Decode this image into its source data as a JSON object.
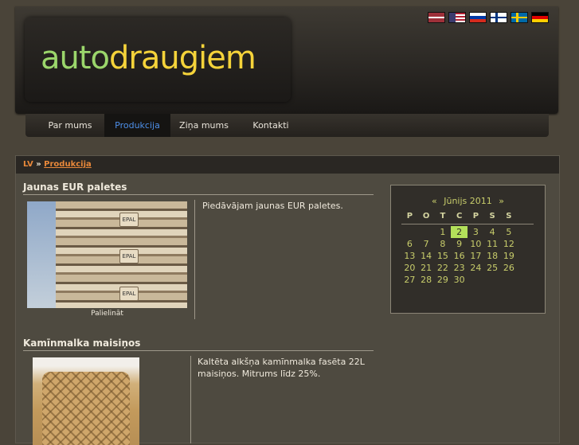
{
  "logo": {
    "part1": "auto",
    "part2": "draugiem"
  },
  "flags": [
    {
      "name": "lv-flag",
      "colors": [
        "#9e3039",
        "#ffffff",
        "#9e3039"
      ]
    },
    {
      "name": "us-flag",
      "colors": [
        "#b22234",
        "#ffffff",
        "#3c3b6e"
      ]
    },
    {
      "name": "ru-flag",
      "colors": [
        "#ffffff",
        "#0039a6",
        "#d52b1e"
      ]
    },
    {
      "name": "fi-flag",
      "colors": [
        "#ffffff",
        "#003580"
      ]
    },
    {
      "name": "se-flag",
      "colors": [
        "#006aa7",
        "#fecc00"
      ]
    },
    {
      "name": "de-flag",
      "colors": [
        "#000000",
        "#dd0000",
        "#ffce00"
      ]
    }
  ],
  "nav": [
    {
      "label": "Par mums",
      "active": false
    },
    {
      "label": "Produkcija",
      "active": true
    },
    {
      "label": "Ziņa mums",
      "active": false
    },
    {
      "label": "Kontakti",
      "active": false
    }
  ],
  "breadcrumb": {
    "root": "LV",
    "separator": "»",
    "current": "Produkcija"
  },
  "products": [
    {
      "title": "Jaunas EUR paletes",
      "description": "Piedāvājam jaunas EUR paletes.",
      "caption": "Palielināt",
      "image": "pallets-image",
      "stamp": "EPAL"
    },
    {
      "title": "Kamīnmalka maisiņos",
      "description": "Kaltēta alkšņa kamīnmalka fasēta 22L maisiņos. Mitrums līdz 25%.",
      "image": "firewood-bag-image"
    }
  ],
  "calendar": {
    "prev": "«",
    "next": "»",
    "month": "Jūnijs 2011",
    "weekdays": [
      "P",
      "O",
      "T",
      "C",
      "P",
      "S",
      "S"
    ],
    "weeks": [
      [
        "",
        "",
        "1",
        "2",
        "3",
        "4",
        "5"
      ],
      [
        "6",
        "7",
        "8",
        "9",
        "10",
        "11",
        "12"
      ],
      [
        "13",
        "14",
        "15",
        "16",
        "17",
        "18",
        "19"
      ],
      [
        "20",
        "21",
        "22",
        "23",
        "24",
        "25",
        "26"
      ],
      [
        "27",
        "28",
        "29",
        "30",
        "",
        "",
        ""
      ]
    ],
    "today": "2",
    "colors": {
      "text": "#c8cd6b",
      "today_bg": "#b3e05a"
    }
  }
}
